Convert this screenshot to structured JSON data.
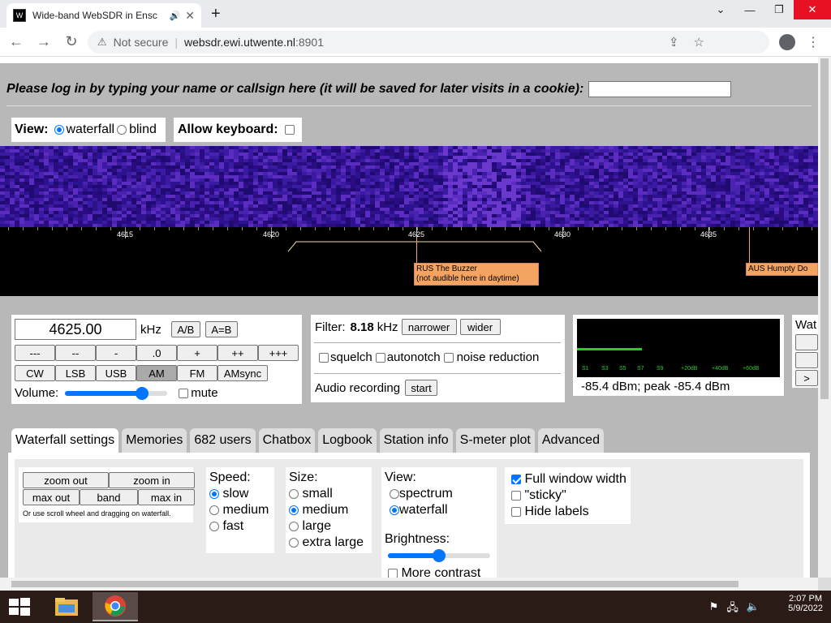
{
  "browser": {
    "tab_title": "Wide-band WebSDR in Ensc",
    "url_security": "Not secure",
    "url_host": "websdr.ewi.utwente.nl",
    "url_port": ":8901"
  },
  "login": {
    "prompt": "Please log in by typing your name or callsign here (it will be saved for later visits in a cookie):"
  },
  "view": {
    "label": "View:",
    "opt_waterfall": "waterfall",
    "opt_blind": "blind",
    "kb_label": "Allow keyboard:"
  },
  "scale": {
    "ticks": [
      "4615",
      "4620",
      "4625",
      "4630",
      "4635"
    ],
    "stations": [
      {
        "name": "RUS The Buzzer",
        "note": "(not audible here in daytime)"
      },
      {
        "name": "AUS Humpty Do",
        "note": ""
      }
    ]
  },
  "tuning": {
    "frequency": "4625.00",
    "unit": "kHz",
    "ab": "A/B",
    "aeqb": "A=B",
    "steps": [
      "---",
      "--",
      "-",
      ".0",
      "+",
      "++",
      "+++"
    ],
    "modes": [
      "CW",
      "LSB",
      "USB",
      "AM",
      "FM",
      "AMsync"
    ],
    "active_mode": "AM",
    "volume_label": "Volume:",
    "volume_level": 0.75,
    "mute_label": "mute"
  },
  "filter": {
    "label": "Filter:",
    "value": "8.18",
    "unit": "kHz",
    "narrower": "narrower",
    "wider": "wider",
    "squelch": "squelch",
    "autonotch": "autonotch",
    "noise_reduction": "noise reduction",
    "audio_recording": "Audio recording",
    "start": "start"
  },
  "smeter": {
    "readout": "-85.4 dBm; peak  -85.4 dBm",
    "scale_labels": [
      "S1",
      "S3",
      "S5",
      "S7",
      "S9",
      "+20dB",
      "+40dB",
      "+60dB"
    ],
    "level": 0.32
  },
  "side_panel": {
    "label": "Wat",
    "btn": ">"
  },
  "tabs": [
    "Waterfall settings",
    "Memories",
    "682 users",
    "Chatbox",
    "Logbook",
    "Station info",
    "S-meter plot",
    "Advanced"
  ],
  "wf_settings": {
    "zoom_out": "zoom out",
    "zoom_in": "zoom in",
    "max_out": "max out",
    "band": "band",
    "max_in": "max in",
    "hint": "Or use scroll wheel and dragging on waterfall.",
    "speed_label": "Speed:",
    "speed_opts": [
      "slow",
      "medium",
      "fast"
    ],
    "size_label": "Size:",
    "size_opts": [
      "small",
      "medium",
      "large",
      "extra large"
    ],
    "view_label": "View:",
    "view_opts": [
      "spectrum",
      "waterfall"
    ],
    "brightness_label": "Brightness:",
    "brightness_level": 0.5,
    "more_contrast": "More contrast",
    "full_width": "Full window width",
    "sticky": "\"sticky\"",
    "hide_labels": "Hide labels"
  },
  "taskbar": {
    "time": "2:07 PM",
    "date": "5/9/2022"
  }
}
